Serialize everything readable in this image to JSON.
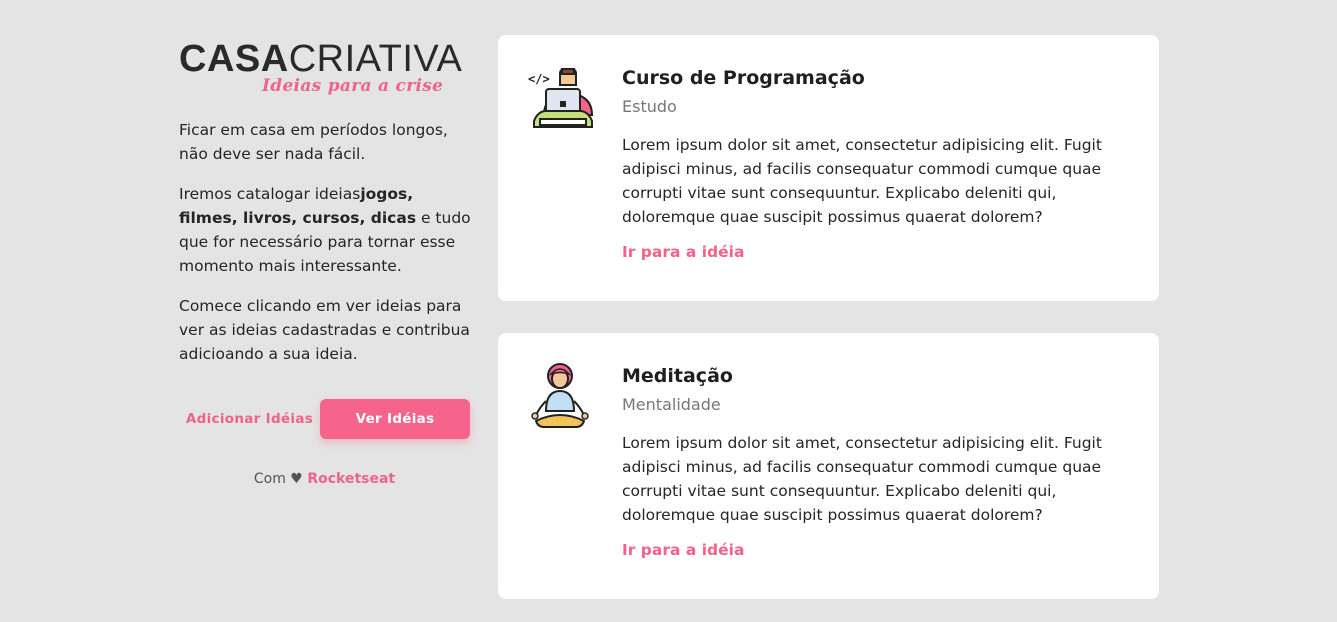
{
  "logo": {
    "part1": "CASA",
    "part2": "CRIATIVA",
    "tagline": "Ideias para a crise"
  },
  "intro": {
    "p1": "Ficar em casa em períodos longos, não deve ser nada fácil.",
    "p2_before": "Iremos catalogar ideias",
    "p2_bold": "jogos, filmes, livros, cursos, dicas",
    "p2_after": " e tudo que for necessário para tornar esse momento mais interessante.",
    "p3": "Comece clicando em ver ideias para ver as ideias cadastradas e contribua adicioando a sua ideia."
  },
  "actions": {
    "add_label": "Adicionar Idéias",
    "see_label": "Ver Idéias"
  },
  "credit": {
    "prefix": "Com ♥ ",
    "brand": "Rocketseat"
  },
  "cards": [
    {
      "icon": "programmer-laptop-icon",
      "title": "Curso de Programação",
      "category": "Estudo",
      "description": "Lorem ipsum dolor sit amet, consectetur adipisicing elit. Fugit adipisci minus, ad facilis consequatur commodi cumque quae corrupti vitae sunt consequuntur. Explicabo deleniti qui, doloremque quae suscipit possimus quaerat dolorem?",
      "link": "Ir para a idéia"
    },
    {
      "icon": "meditation-person-icon",
      "title": "Meditação",
      "category": "Mentalidade",
      "description": "Lorem ipsum dolor sit amet, consectetur adipisicing elit. Fugit adipisci minus, ad facilis consequatur commodi cumque quae corrupti vitae sunt consequuntur. Explicabo deleniti qui, doloremque quae suscipit possimus quaerat dolorem?",
      "link": "Ir para a idéia"
    }
  ],
  "colors": {
    "accent": "#f6648c",
    "background": "#e4e4e4",
    "card": "#ffffff"
  }
}
